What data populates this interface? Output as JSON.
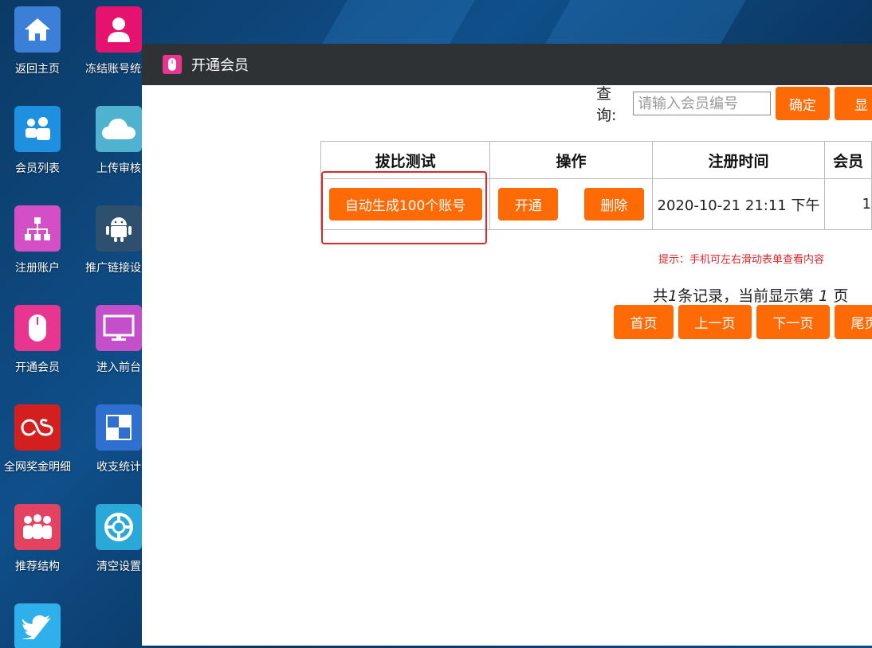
{
  "desktop": {
    "icons": [
      {
        "label": "返回主页",
        "icon": "home-icon",
        "color": "#3b7fd8"
      },
      {
        "label": "冻结账号统计",
        "icon": "user-icon",
        "color": "#e5126f"
      },
      {
        "label": "会员列表",
        "icon": "users-icon",
        "color": "#1f8fe0"
      },
      {
        "label": "上传审核",
        "icon": "cloud-icon",
        "color": "#4fb3cf"
      },
      {
        "label": "注册账户",
        "icon": "org-chart-icon",
        "color": "#d44fc5"
      },
      {
        "label": "推广链接设置",
        "icon": "android-icon",
        "color": "#2f4f6f"
      },
      {
        "label": "开通会员",
        "icon": "mouse-icon",
        "color": "#e8358f"
      },
      {
        "label": "进入前台",
        "icon": "monitor-icon",
        "color": "#c44fcb"
      },
      {
        "label": "全网奖金明细",
        "icon": "lastfm-icon",
        "color": "#d41f1f"
      },
      {
        "label": "收支统计",
        "icon": "grid-icon",
        "color": "#2f6fcf"
      },
      {
        "label": "推荐结构",
        "icon": "family-icon",
        "color": "#e34361"
      },
      {
        "label": "清空设置",
        "icon": "lifebuoy-icon",
        "color": "#2aa9d8"
      },
      {
        "label": "",
        "icon": "twitter-icon",
        "color": "#2fb0ea"
      }
    ]
  },
  "window": {
    "title": "开通会员",
    "search": {
      "label": "查询:",
      "placeholder": "请输入会员编号",
      "confirm": "确定",
      "next_cut": "显"
    },
    "table": {
      "headers": [
        "拔比测试",
        "操作",
        "注册时间",
        "会员"
      ],
      "row": {
        "generate": "自动生成100个账号",
        "open": "开通",
        "delete": "删除",
        "time": "2020-10-21 21:11 下午",
        "member_cut": "1"
      }
    },
    "hint": "提示：手机可左右滑动表单查看内容",
    "records": {
      "prefix": "共",
      "count": "1",
      "middle": "条记录，当前显示第",
      "page": "1",
      "suffix": "页"
    },
    "pager": {
      "first": "首页",
      "prev": "上一页",
      "next": "下一页",
      "last": "尾页"
    }
  }
}
